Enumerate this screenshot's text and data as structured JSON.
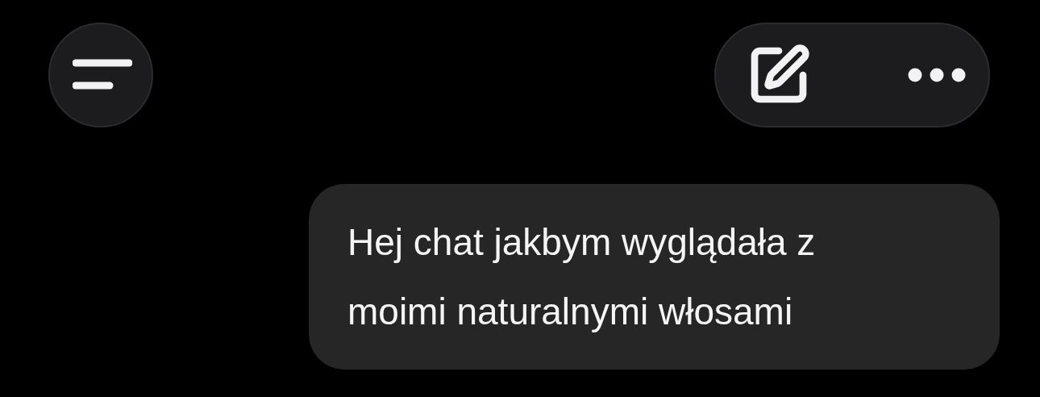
{
  "message": {
    "text": "Hej chat jakbym wyglądała z moimi naturalnymi włosami"
  }
}
